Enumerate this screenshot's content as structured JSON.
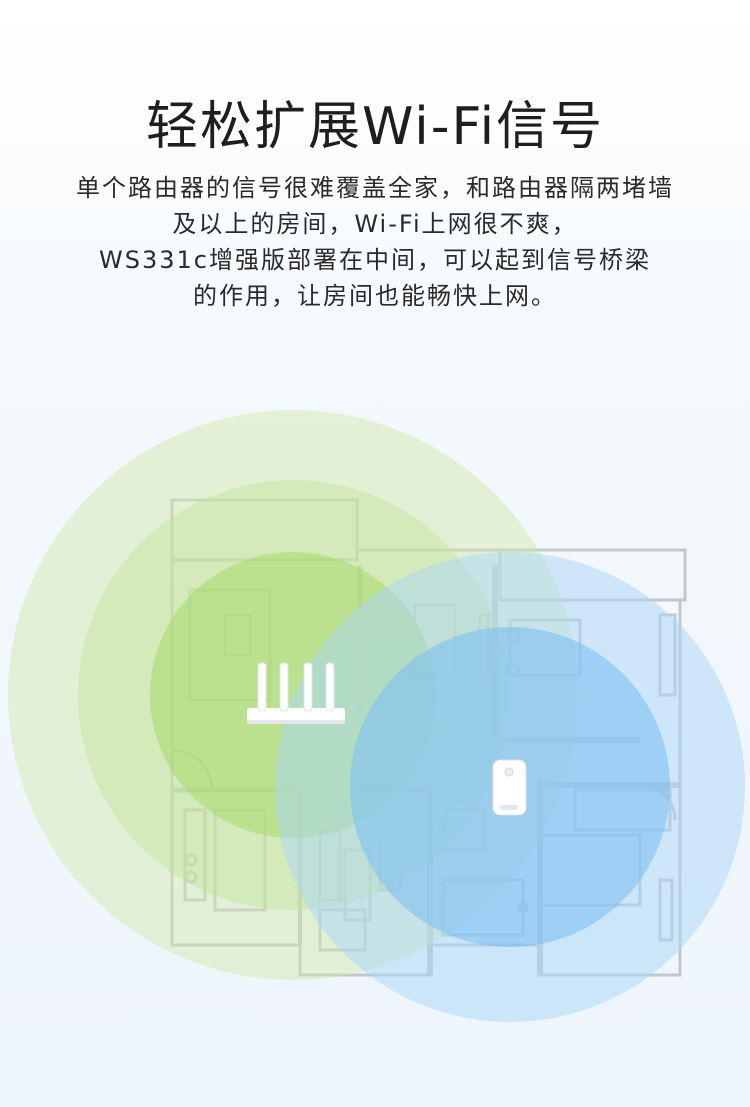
{
  "title": "轻松扩展Wi-Fi信号",
  "description": [
    "单个路由器的信号很难覆盖全家，和路由器隔两堵墙",
    "及以上的房间，Wi-Fi上网很不爽，",
    "WS331c增强版部署在中间，可以起到信号桥梁",
    "的作用，让房间也能畅快上网。"
  ],
  "colors": {
    "router_coverage": "#c5e7a0",
    "extender_coverage": "#9fd1f7",
    "floorplan": "#b8bcc0"
  },
  "illustration": {
    "router_icon": "wifi-router-icon",
    "extender_icon": "wifi-extender-icon"
  }
}
